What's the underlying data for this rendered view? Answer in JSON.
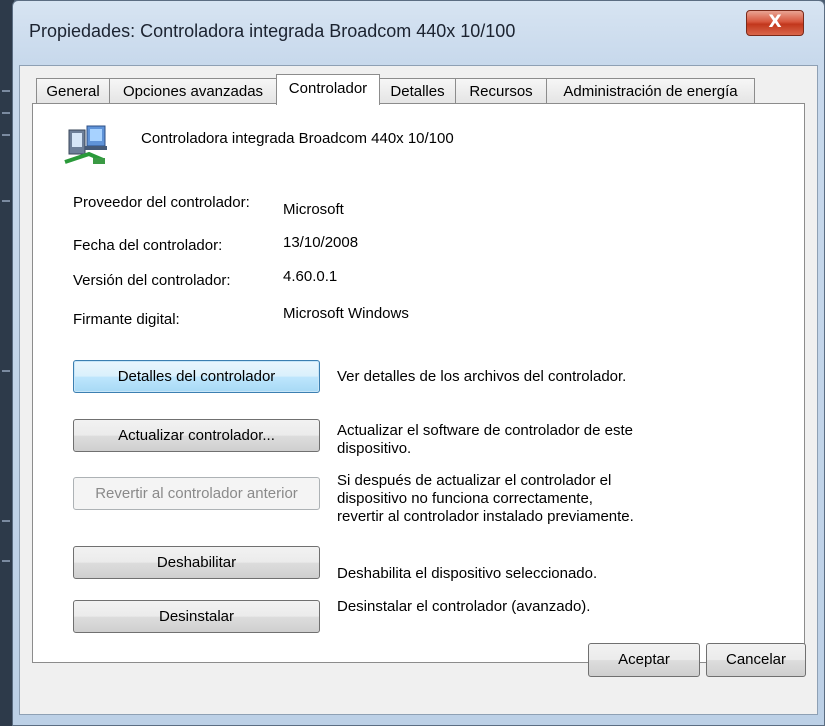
{
  "window": {
    "title": "Propiedades: Controladora integrada Broadcom 440x 10/100",
    "close_glyph": "X"
  },
  "tabs": [
    {
      "label": "General"
    },
    {
      "label": "Opciones avanzadas"
    },
    {
      "label": "Controlador",
      "active": true
    },
    {
      "label": "Detalles"
    },
    {
      "label": "Recursos"
    },
    {
      "label": "Administración de energía"
    }
  ],
  "device": {
    "icon": "network-adapter-icon",
    "name": "Controladora integrada Broadcom 440x 10/100"
  },
  "info": {
    "provider_label": "Proveedor del controlador:",
    "provider_value": "Microsoft",
    "date_label": "Fecha del controlador:",
    "date_value": "13/10/2008",
    "version_label": "Versión del controlador:",
    "version_value": "4.60.0.1",
    "signer_label": "Firmante digital:",
    "signer_value": "Microsoft Windows"
  },
  "actions": [
    {
      "label": "Detalles del controlador",
      "description": "Ver detalles de los archivos del controlador.",
      "state": "focused"
    },
    {
      "label": "Actualizar controlador...",
      "description": "Actualizar el software de controlador de este dispositivo.",
      "state": "normal"
    },
    {
      "label": "Revertir al controlador anterior",
      "description": "Si después de actualizar el controlador el dispositivo no funciona correctamente, revertir al controlador instalado previamente.",
      "state": "disabled"
    },
    {
      "label": "Deshabilitar",
      "description": "Deshabilita el dispositivo seleccionado.",
      "state": "normal"
    },
    {
      "label": "Desinstalar",
      "description": "Desinstalar el controlador (avanzado).",
      "state": "normal"
    }
  ],
  "footer": {
    "ok_label": "Aceptar",
    "cancel_label": "Cancelar"
  }
}
